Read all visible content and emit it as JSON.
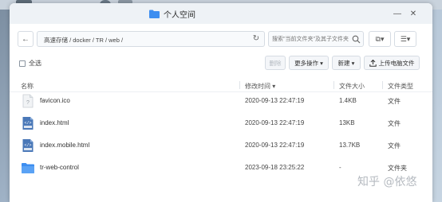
{
  "window": {
    "title": "个人空间",
    "minimize_glyph": "—",
    "close_glyph": "✕"
  },
  "address_bar": {
    "back_glyph": "←",
    "path": "高速存储 / docker / TR / web /",
    "refresh_glyph": "↻"
  },
  "search": {
    "placeholder": "搜索\"当前文件夹\"及其子文件夹"
  },
  "view_controls": {
    "filter_glyph": "⧉▾",
    "sort_glyph": "☰▾"
  },
  "toolbar": {
    "select_all_label": "全选",
    "delete_label": "删除",
    "more_label": "更多操作 ▾",
    "new_label": "新建 ▾",
    "upload_label": "上传电脑文件"
  },
  "table": {
    "headers": {
      "name": "名称",
      "modified": "修改时间 ▾",
      "size": "文件大小",
      "type": "文件类型"
    },
    "rows": [
      {
        "icon": "unknown-file-icon",
        "name": "favicon.ico",
        "modified": "2020-09-13 22:47:19",
        "size": "1.4KB",
        "type": "文件"
      },
      {
        "icon": "html-file-icon",
        "name": "index.html",
        "modified": "2020-09-13 22:47:19",
        "size": "13KB",
        "type": "文件"
      },
      {
        "icon": "html-file-icon",
        "name": "index.mobile.html",
        "modified": "2020-09-13 22:47:19",
        "size": "13.7KB",
        "type": "文件"
      },
      {
        "icon": "folder-icon",
        "name": "tr-web-control",
        "modified": "2023-09-18 23:25:22",
        "size": "-",
        "type": "文件夹"
      }
    ]
  },
  "watermark": "知乎 @依悠",
  "colors": {
    "accent": "#2f80ed",
    "folder": "#3d8ef0",
    "html_icon": "#4a78b8",
    "titlebar": "#eef2f6"
  }
}
